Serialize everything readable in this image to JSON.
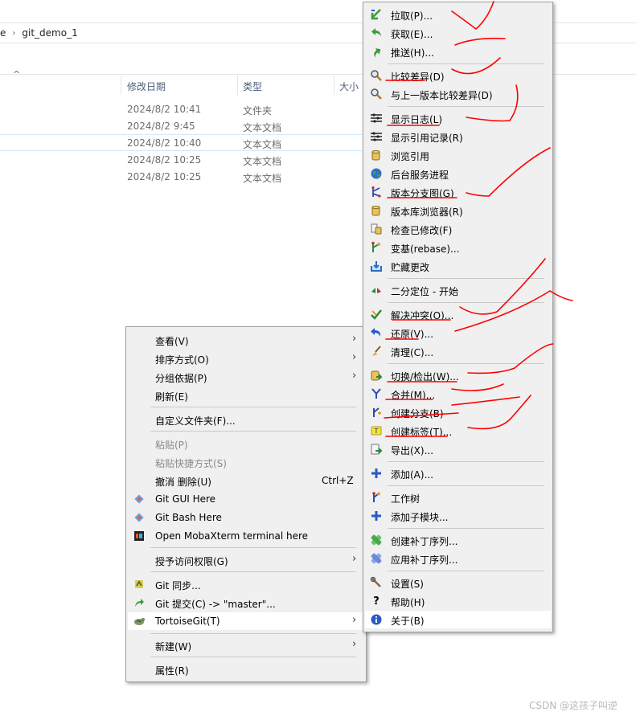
{
  "explorer": {
    "breadcrumb_prev": "e",
    "breadcrumb_current": "git_demo_1",
    "columns": {
      "date": "修改日期",
      "type": "类型",
      "size": "大小"
    },
    "rows": [
      {
        "date": "2024/8/2 10:41",
        "type": "文件夹"
      },
      {
        "date": "2024/8/2 9:45",
        "type": "文本文档"
      },
      {
        "date": "2024/8/2 10:40",
        "type": "文本文档"
      },
      {
        "date": "2024/8/2 10:25",
        "type": "文本文档"
      },
      {
        "date": "2024/8/2 10:25",
        "type": "文本文档"
      }
    ]
  },
  "context_menu": {
    "view": "查看(V)",
    "sort": "排序方式(O)",
    "group": "分组依据(P)",
    "refresh": "刷新(E)",
    "customize": "自定义文件夹(F)...",
    "paste": "粘贴(P)",
    "paste_shortcut": "粘贴快捷方式(S)",
    "undo": "撤消 删除(U)",
    "undo_shortcut": "Ctrl+Z",
    "git_gui": "Git GUI Here",
    "git_bash": "Git Bash Here",
    "moba": "Open MobaXterm terminal here",
    "grant_access": "授予访问权限(G)",
    "git_sync": "Git 同步...",
    "git_commit": "Git 提交(C) -> \"master\"...",
    "tortoisegit": "TortoiseGit(T)",
    "new": "新建(W)",
    "properties": "属性(R)"
  },
  "tortoise_menu": {
    "pull": "拉取(P)...",
    "fetch": "获取(E)...",
    "push": "推送(H)...",
    "diff": "比较差异(D)",
    "diff_prev": "与上一版本比较差异(D)",
    "show_log": "显示日志(L)",
    "reflog": "显示引用记录(R)",
    "browse_refs": "浏览引用",
    "daemon": "后台服务进程",
    "revision_graph": "版本分支图(G)",
    "repo_browser": "版本库浏览器(R)",
    "check_mods": "检查已修改(F)",
    "rebase": "变基(rebase)...",
    "stash": "贮藏更改",
    "bisect": "二分定位 - 开始",
    "resolve": "解决冲突(O)...",
    "revert": "还原(V)...",
    "cleanup": "清理(C)...",
    "switch": "切换/检出(W)...",
    "merge": "合并(M)...",
    "create_branch": "创建分支(B)",
    "create_tag": "创建标签(T)...",
    "export": "导出(X)...",
    "add": "添加(A)...",
    "worktree": "工作树",
    "add_submodule": "添加子模块...",
    "create_patch": "创建补丁序列...",
    "apply_patch": "应用补丁序列...",
    "settings": "设置(S)",
    "help": "帮助(H)",
    "about": "关于(B)"
  },
  "watermark": "CSDN @这孩子叫逆",
  "colors": {
    "menu_bg": "#f0f0f0",
    "annotation_red": "#ff0000",
    "selected_border": "#cde8ff"
  }
}
